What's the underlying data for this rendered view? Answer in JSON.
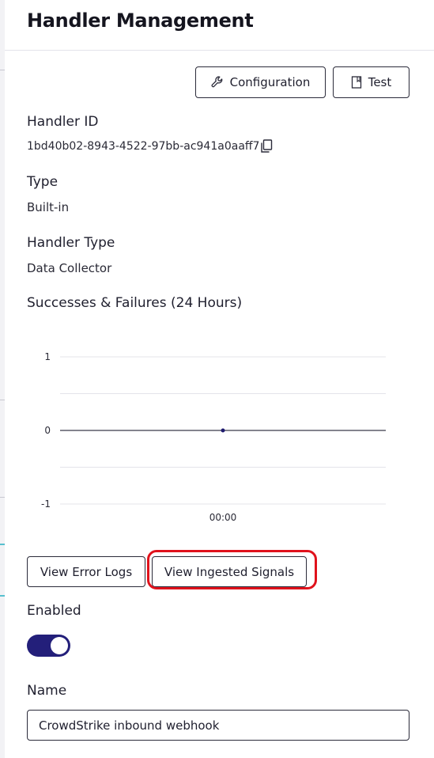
{
  "header": {
    "title": "Handler Management"
  },
  "toolbar": {
    "configuration_label": "Configuration",
    "configuration_icon": "wrench-icon",
    "test_label": "Test",
    "test_icon": "bookmark-icon"
  },
  "details": {
    "handler_id_label": "Handler ID",
    "handler_id_value": "1bd40b02-8943-4522-97bb-ac941a0aaff7",
    "copy_icon": "copy-icon",
    "type_label": "Type",
    "type_value": "Built-in",
    "handler_type_label": "Handler Type",
    "handler_type_value": "Data Collector"
  },
  "chart_section": {
    "title": "Successes & Failures (24 Hours)"
  },
  "chart_data": {
    "type": "line",
    "x": [
      "00:00"
    ],
    "series": [
      {
        "values": [
          0
        ]
      }
    ],
    "y_ticks": [
      1,
      0,
      -1
    ],
    "ylim": [
      -1,
      1
    ],
    "grid": true,
    "colors": {
      "series": "#1e1a6e",
      "grid": "#e4e4ea",
      "zero_line": "#3a3a4a"
    }
  },
  "actions": {
    "view_error_logs_label": "View Error Logs",
    "view_ingested_signals_label": "View Ingested Signals"
  },
  "enabled": {
    "label": "Enabled",
    "value": true,
    "color": "#231f7a"
  },
  "name": {
    "label": "Name",
    "value": "CrowdStrike inbound webhook"
  },
  "colors": {
    "highlight": "#e0121c",
    "accent": "#231f7a"
  }
}
